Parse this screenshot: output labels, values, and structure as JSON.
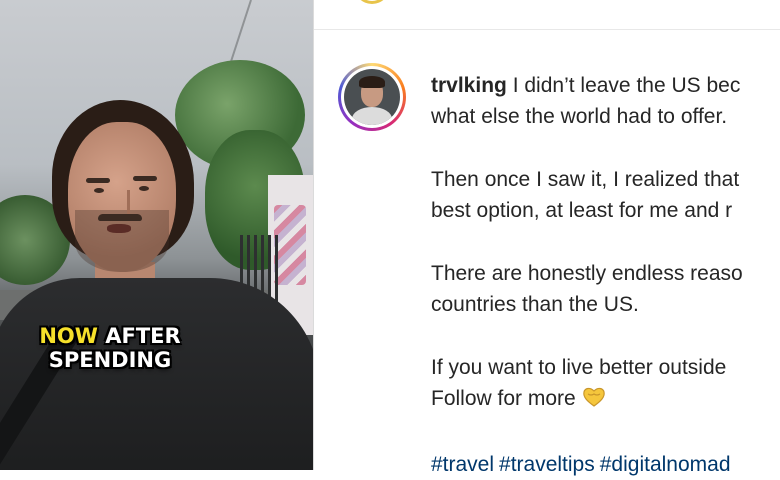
{
  "video": {
    "caption_line1_highlight": "NOW",
    "caption_line1_rest": " AFTER",
    "caption_line2": "SPENDING"
  },
  "post": {
    "username": "trvlking",
    "caption_line1": " I didn’t leave the US bec",
    "caption_line2": "what else the world had to offer.",
    "para2_line1": "Then once I saw it, I realized that",
    "para2_line2": "best option, at least for me and r",
    "para3_line1": "There are honestly endless reaso",
    "para3_line2": "countries than the US.",
    "para4_line1": "If you want to live better outside",
    "para4_line2": "Follow for more",
    "emoji": "yellow-heart-hands",
    "hashtags": [
      "#travel",
      "#traveltips",
      "#digitalnomad"
    ]
  },
  "colors": {
    "caption_highlight": "#f6e12a",
    "hashtag": "#00376b",
    "text": "#262626"
  }
}
